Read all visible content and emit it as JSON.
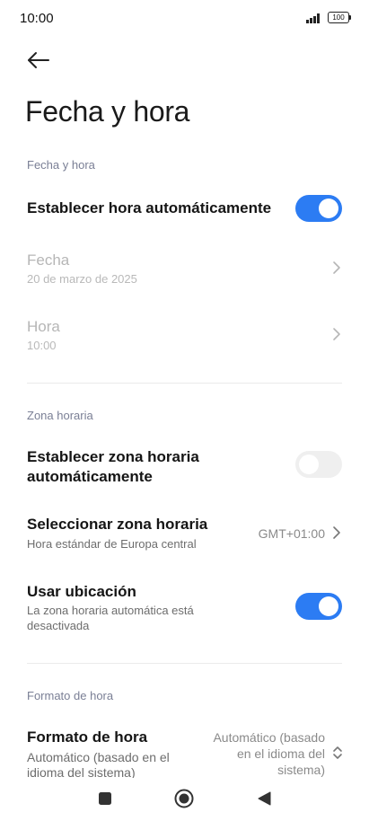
{
  "status_bar": {
    "time": "10:00",
    "battery": "100"
  },
  "page": {
    "title": "Fecha y hora"
  },
  "sections": {
    "date_time": "Fecha y hora",
    "time_zone": "Zona horaria",
    "time_format": "Formato de hora"
  },
  "settings": {
    "auto_time": {
      "title": "Establecer hora automáticamente",
      "enabled": true
    },
    "date": {
      "title": "Fecha",
      "value": "20 de marzo de 2025"
    },
    "time": {
      "title": "Hora",
      "value": "10:00"
    },
    "auto_zone": {
      "title_line1": "Establecer zona horaria",
      "title_line2": "automáticamente",
      "enabled": false
    },
    "select_zone": {
      "title": "Seleccionar zona horaria",
      "subtitle": "Hora estándar de Europa central",
      "value": "GMT+01:00"
    },
    "use_location": {
      "title": "Usar ubicación",
      "subtitle_line1": "La zona horaria automática está",
      "subtitle_line2": "desactivada",
      "enabled": true
    },
    "time_format": {
      "title": "Formato de hora",
      "subtitle_line1": "Automático (basado en el",
      "subtitle_line2": "idioma del sistema)",
      "value_line1": "Automático (basado",
      "value_line2": "en el idioma del",
      "value_line3": "sistema)"
    }
  },
  "icons": {
    "back": "back-arrow-icon",
    "chevron": "chevron-right-icon",
    "updown": "chevron-updown-icon",
    "signal": "signal-icon",
    "nav_recents": "recents-icon",
    "nav_home": "home-icon",
    "nav_back": "nav-back-icon"
  },
  "colors": {
    "accent": "#2c7cf3",
    "section_label": "#7a7f95",
    "disabled_text": "#b6b6b6"
  }
}
